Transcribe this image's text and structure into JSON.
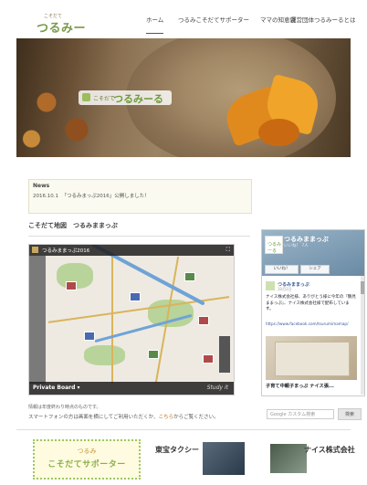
{
  "header": {
    "logo_small": "こそだて",
    "logo_big": "つるみーる",
    "nav": [
      "ホーム",
      "つるみこそだてサポーター",
      "ママの知恵袋",
      "運営団体つるみーるとは"
    ]
  },
  "hero": {
    "badge_small": "こそだて",
    "badge_big": "つるみーる"
  },
  "news": {
    "title": "News",
    "date": "2016.10.1",
    "text": "「つるみまっぷ2016」公開しました！"
  },
  "section_title": "こそだて地図　つるみままっぷ",
  "map": {
    "title": "つるみままっぷ2016",
    "bottom_left": "Private Board ▾",
    "bottom_right": "Study it",
    "fullscreen_icon": "fullscreen-icon"
  },
  "map_notes": {
    "line1": "情報は年度終わり時点のものです。",
    "line2_before": "スマートフォンの方は画面を横にしてご利用いただくか、",
    "line2_link": "こちら",
    "line2_after": "からご覧ください。"
  },
  "facebook": {
    "page_name": "つるみままっぷ",
    "page_sub": "いいね！ 7人",
    "like_label": "いいね！",
    "share_label": "シェア",
    "post_name": "つるみままっぷ",
    "post_date": "10月1日",
    "post_text": "ナイス株式会社様、ありがとう様に今年の『鶴見ままっぷ』、ナイス株式会社様で配布しています。",
    "post_link": "https://www.facebook.com/tsurumimamap/",
    "post_title": "子育て中親子まっぷ ナイス張..."
  },
  "search": {
    "placeholder": "Google カスタム検索",
    "button": "検索"
  },
  "sponsors": {
    "s1_top": "つるみ",
    "s1_bottom": "こそだてサポーター",
    "s2": "東宝タクシー",
    "s3": "ナイス株式会社"
  },
  "colors": {
    "accent_green": "#7a9a4a",
    "link_orange": "#c06a1a",
    "fb_blue": "#385898"
  }
}
